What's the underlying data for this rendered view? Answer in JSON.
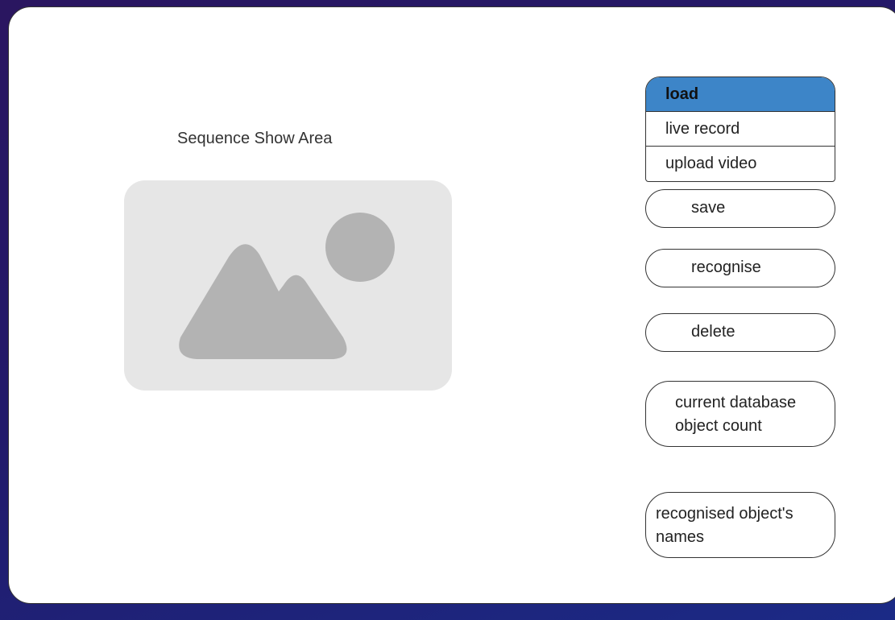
{
  "main": {
    "sequence_label": "Sequence Show Area",
    "image_placeholder": {
      "icon": "image-placeholder-icon",
      "background": "#e6e6e6",
      "shape_color": "#b3b3b3"
    }
  },
  "sidebar": {
    "load_menu": {
      "header": "load",
      "items": [
        "live record",
        "upload video"
      ],
      "accent": "#3d85c8"
    },
    "buttons": {
      "save": "save",
      "recognise": "recognise",
      "delete": "delete"
    },
    "info": {
      "count_line1": "current database",
      "count_line2": "object count",
      "names_line1": "recognised object's",
      "names_line2": "names"
    }
  }
}
